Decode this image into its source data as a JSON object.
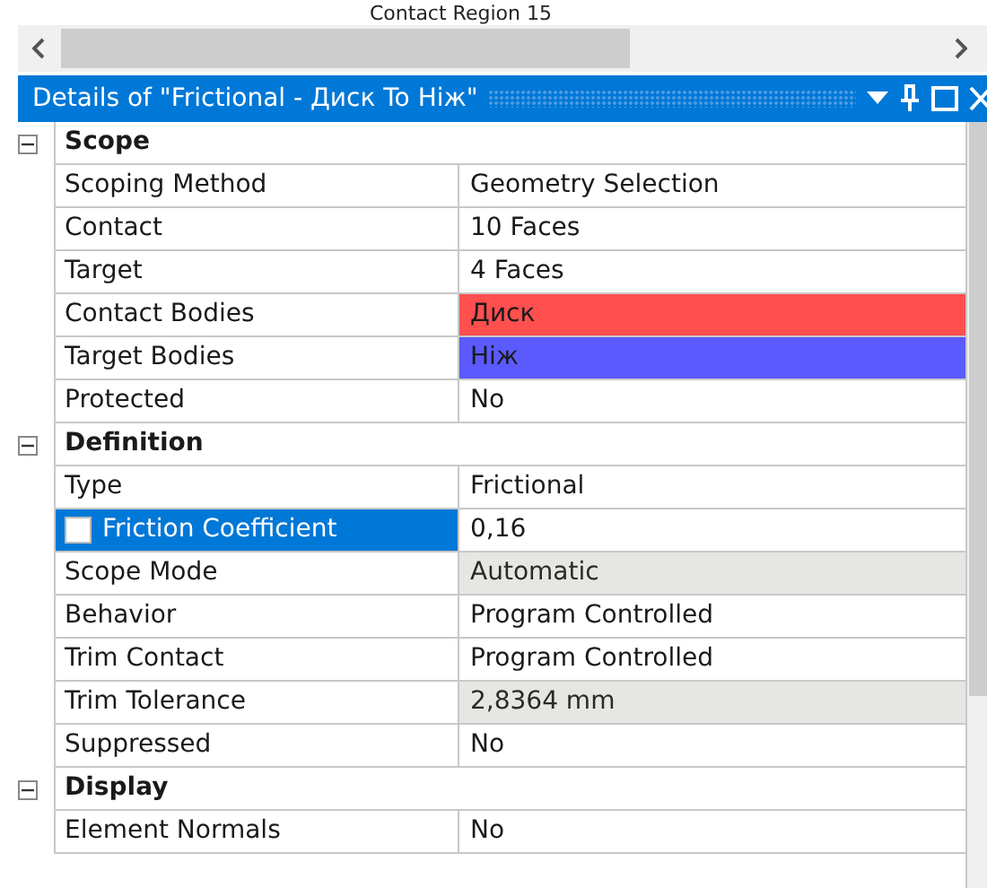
{
  "tree_row": {
    "label": "Contact Region 15"
  },
  "panel": {
    "title": "Details of \"Frictional - Диск To Ніж\""
  },
  "sections": [
    {
      "title": "Scope",
      "expanded": true,
      "rows": [
        {
          "kind": "plain",
          "label": "Scoping Method",
          "value": "Geometry Selection",
          "readonly": false,
          "selected": false
        },
        {
          "kind": "plain",
          "label": "Contact",
          "value": "10 Faces",
          "readonly": false,
          "selected": false
        },
        {
          "kind": "plain",
          "label": "Target",
          "value": "4 Faces",
          "readonly": false,
          "selected": false
        },
        {
          "kind": "plain",
          "label": "Contact Bodies",
          "value": "Диск",
          "readonly": false,
          "selected": false,
          "color": "#ff4f4f"
        },
        {
          "kind": "plain",
          "label": "Target Bodies",
          "value": "Ніж",
          "readonly": false,
          "selected": false,
          "color": "#5a5aff"
        },
        {
          "kind": "plain",
          "label": "Protected",
          "value": "No",
          "readonly": false,
          "selected": false
        }
      ]
    },
    {
      "title": "Definition",
      "expanded": true,
      "rows": [
        {
          "kind": "plain",
          "label": "Type",
          "value": "Frictional",
          "readonly": false,
          "selected": false
        },
        {
          "kind": "parameter",
          "label": "Friction Coefficient",
          "value": "0,16",
          "readonly": false,
          "selected": true,
          "checked": false
        },
        {
          "kind": "plain",
          "label": "Scope Mode",
          "value": "Automatic",
          "readonly": true,
          "selected": false
        },
        {
          "kind": "plain",
          "label": "Behavior",
          "value": "Program Controlled",
          "readonly": false,
          "selected": false
        },
        {
          "kind": "plain",
          "label": "Trim Contact",
          "value": "Program Controlled",
          "readonly": false,
          "selected": false
        },
        {
          "kind": "plain",
          "label": "Trim Tolerance",
          "value": "2,8364 mm",
          "readonly": true,
          "selected": false
        },
        {
          "kind": "plain",
          "label": "Suppressed",
          "value": "No",
          "readonly": false,
          "selected": false
        }
      ]
    },
    {
      "title": "Display",
      "expanded": true,
      "rows": [
        {
          "kind": "plain",
          "label": "Element Normals",
          "value": "No",
          "readonly": false,
          "selected": false
        }
      ]
    }
  ]
}
